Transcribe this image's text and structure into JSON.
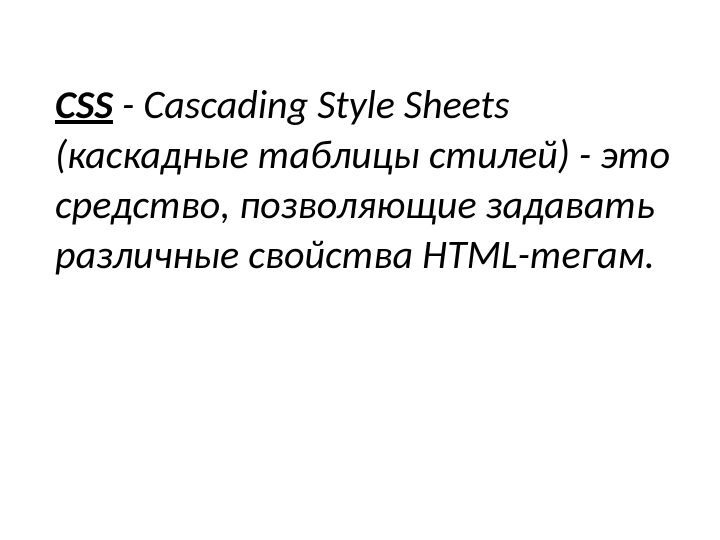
{
  "definition": {
    "term": "CSS",
    "separator": " - ",
    "text": "Cascading Style Sheets (каскадные таблицы стилей) - это средство, позволяющие задавать различные свойства HTML-тегам."
  }
}
